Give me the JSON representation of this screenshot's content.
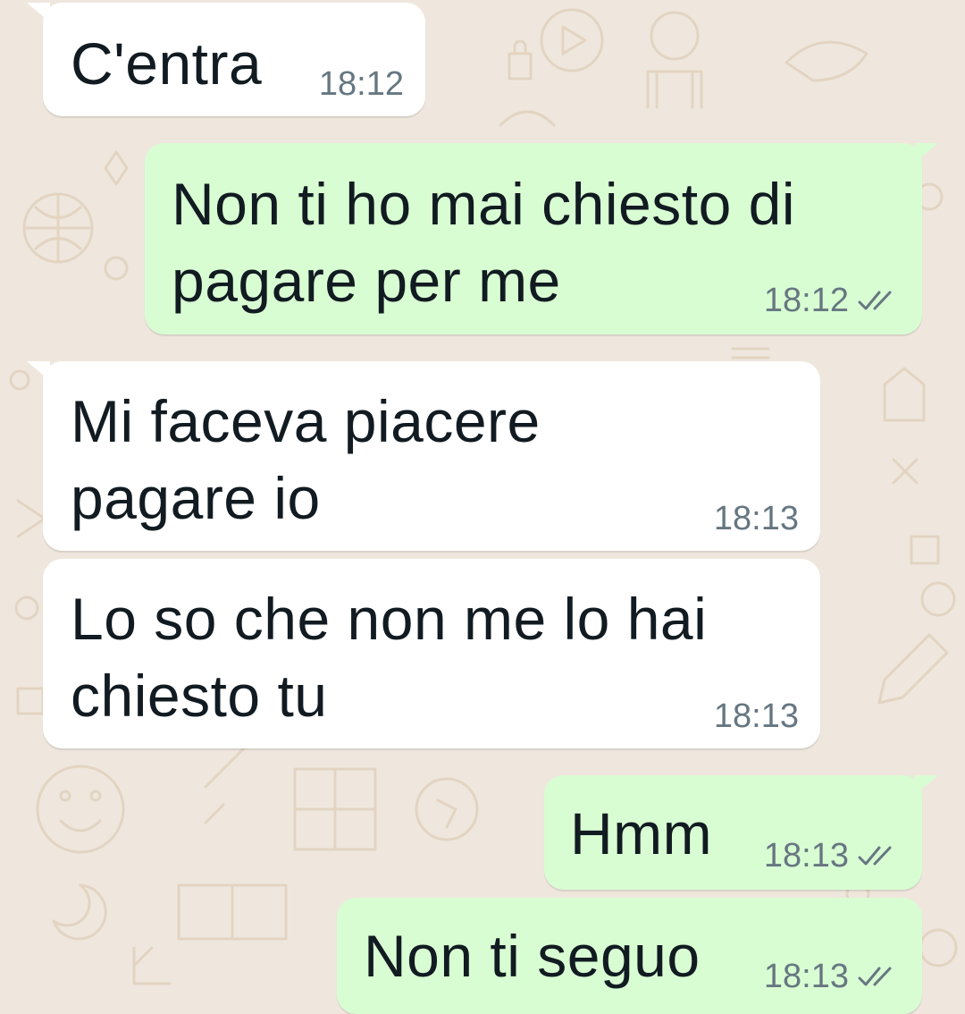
{
  "colors": {
    "wallpaper": "#efe7dd",
    "incoming_bubble": "#ffffff",
    "outgoing_bubble": "#d9fdd3",
    "message_text": "#111b21",
    "timestamp": "#667781"
  },
  "messages": [
    {
      "direction": "incoming",
      "text": "C'entra",
      "time": "18:12"
    },
    {
      "direction": "outgoing",
      "text": "Non ti ho mai chiesto di\npagare per me",
      "time": "18:12",
      "status_icon": "double-check-icon"
    },
    {
      "direction": "incoming",
      "text": "Mi faceva piacere\npagare io",
      "time": "18:13"
    },
    {
      "direction": "incoming",
      "text": "Lo so che non me lo hai\nchiesto tu",
      "time": "18:13"
    },
    {
      "direction": "outgoing",
      "text": "Hmm",
      "time": "18:13",
      "status_icon": "double-check-icon"
    },
    {
      "direction": "outgoing",
      "text": "Non ti seguo",
      "time": "18:13",
      "status_icon": "double-check-icon"
    }
  ]
}
